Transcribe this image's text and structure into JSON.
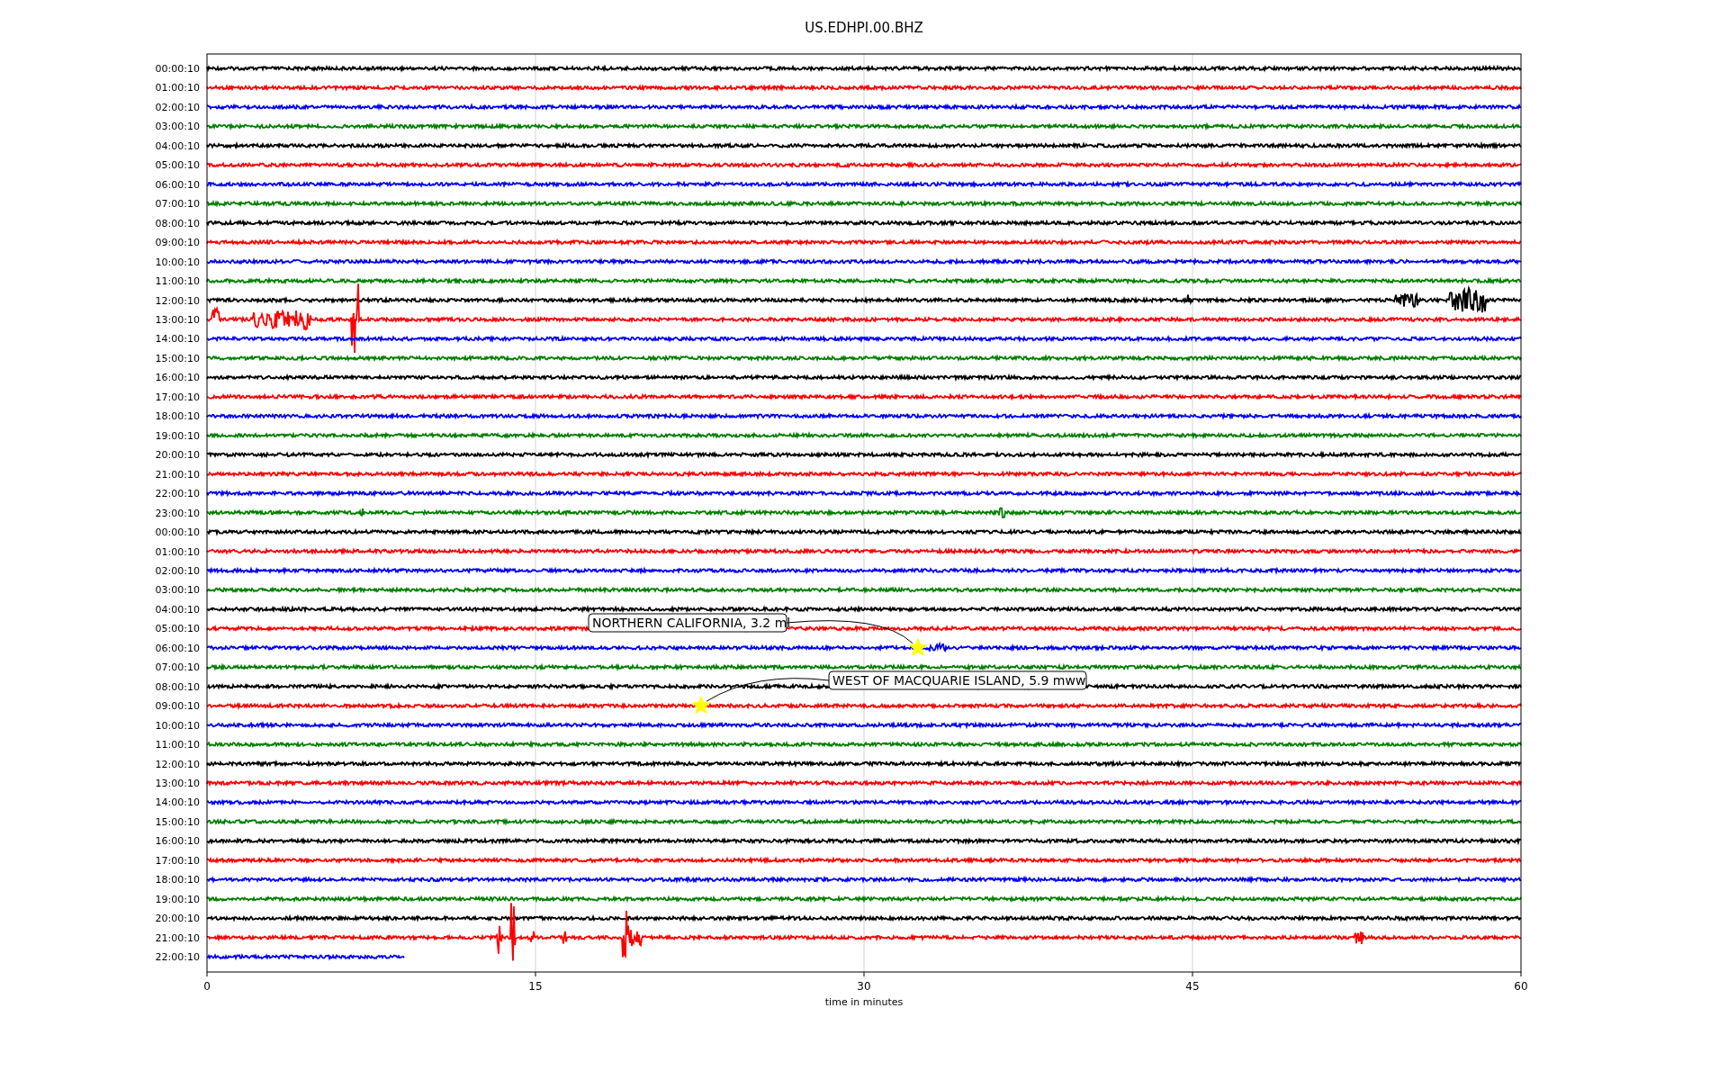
{
  "title": "US.EDHPI.00.BHZ",
  "xlabel": "time in minutes",
  "xticks": [
    "0",
    "15",
    "30",
    "45",
    "60"
  ],
  "traces": [
    {
      "label": "00:00:10",
      "color": "#000000",
      "level": 1
    },
    {
      "label": "01:00:10",
      "color": "#ff0000",
      "level": 1
    },
    {
      "label": "02:00:10",
      "color": "#0000ff",
      "level": 1
    },
    {
      "label": "03:00:10",
      "color": "#008000",
      "level": 1
    },
    {
      "label": "04:00:10",
      "color": "#000000",
      "level": 1
    },
    {
      "label": "05:00:10",
      "color": "#ff0000",
      "level": 1
    },
    {
      "label": "06:00:10",
      "color": "#0000ff",
      "level": 1
    },
    {
      "label": "07:00:10",
      "color": "#008000",
      "level": 1
    },
    {
      "label": "08:00:10",
      "color": "#000000",
      "level": 1
    },
    {
      "label": "09:00:10",
      "color": "#ff0000",
      "level": 1
    },
    {
      "label": "10:00:10",
      "color": "#0000ff",
      "level": 1
    },
    {
      "label": "11:00:10",
      "color": "#008000",
      "level": 1
    },
    {
      "label": "12:00:10",
      "color": "#000000",
      "level": 1
    },
    {
      "label": "13:00:10",
      "color": "#ff0000",
      "level": 1
    },
    {
      "label": "14:00:10",
      "color": "#0000ff",
      "level": 1
    },
    {
      "label": "15:00:10",
      "color": "#008000",
      "level": 1
    },
    {
      "label": "16:00:10",
      "color": "#000000",
      "level": 1
    },
    {
      "label": "17:00:10",
      "color": "#ff0000",
      "level": 1
    },
    {
      "label": "18:00:10",
      "color": "#0000ff",
      "level": 1
    },
    {
      "label": "19:00:10",
      "color": "#008000",
      "level": 1
    },
    {
      "label": "20:00:10",
      "color": "#000000",
      "level": 1
    },
    {
      "label": "21:00:10",
      "color": "#ff0000",
      "level": 1
    },
    {
      "label": "22:00:10",
      "color": "#0000ff",
      "level": 1
    },
    {
      "label": "23:00:10",
      "color": "#008000",
      "level": 1
    },
    {
      "label": "00:00:10",
      "color": "#000000",
      "level": 1
    },
    {
      "label": "01:00:10",
      "color": "#ff0000",
      "level": 1
    },
    {
      "label": "02:00:10",
      "color": "#0000ff",
      "level": 1
    },
    {
      "label": "03:00:10",
      "color": "#008000",
      "level": 1
    },
    {
      "label": "04:00:10",
      "color": "#000000",
      "level": 1
    },
    {
      "label": "05:00:10",
      "color": "#ff0000",
      "level": 1
    },
    {
      "label": "06:00:10",
      "color": "#0000ff",
      "level": 1
    },
    {
      "label": "07:00:10",
      "color": "#008000",
      "level": 1
    },
    {
      "label": "08:00:10",
      "color": "#000000",
      "level": 1
    },
    {
      "label": "09:00:10",
      "color": "#ff0000",
      "level": 1
    },
    {
      "label": "10:00:10",
      "color": "#0000ff",
      "level": 1
    },
    {
      "label": "11:00:10",
      "color": "#008000",
      "level": 1
    },
    {
      "label": "12:00:10",
      "color": "#000000",
      "level": 1
    },
    {
      "label": "13:00:10",
      "color": "#ff0000",
      "level": 1
    },
    {
      "label": "14:00:10",
      "color": "#0000ff",
      "level": 1
    },
    {
      "label": "15:00:10",
      "color": "#008000",
      "level": 1
    },
    {
      "label": "16:00:10",
      "color": "#000000",
      "level": 1
    },
    {
      "label": "17:00:10",
      "color": "#ff0000",
      "level": 1
    },
    {
      "label": "18:00:10",
      "color": "#0000ff",
      "level": 1
    },
    {
      "label": "19:00:10",
      "color": "#008000",
      "level": 1
    },
    {
      "label": "20:00:10",
      "color": "#000000",
      "level": 1
    },
    {
      "label": "21:00:10",
      "color": "#ff0000",
      "level": 1
    },
    {
      "label": "22:00:10",
      "color": "#0000ff",
      "level": 0.15
    }
  ],
  "annotations": [
    {
      "text": "NORTHERN CALIFORNIA, 3.2 ml"
    },
    {
      "text": "WEST OF MACQUARIE ISLAND, 5.9 mww"
    }
  ]
}
